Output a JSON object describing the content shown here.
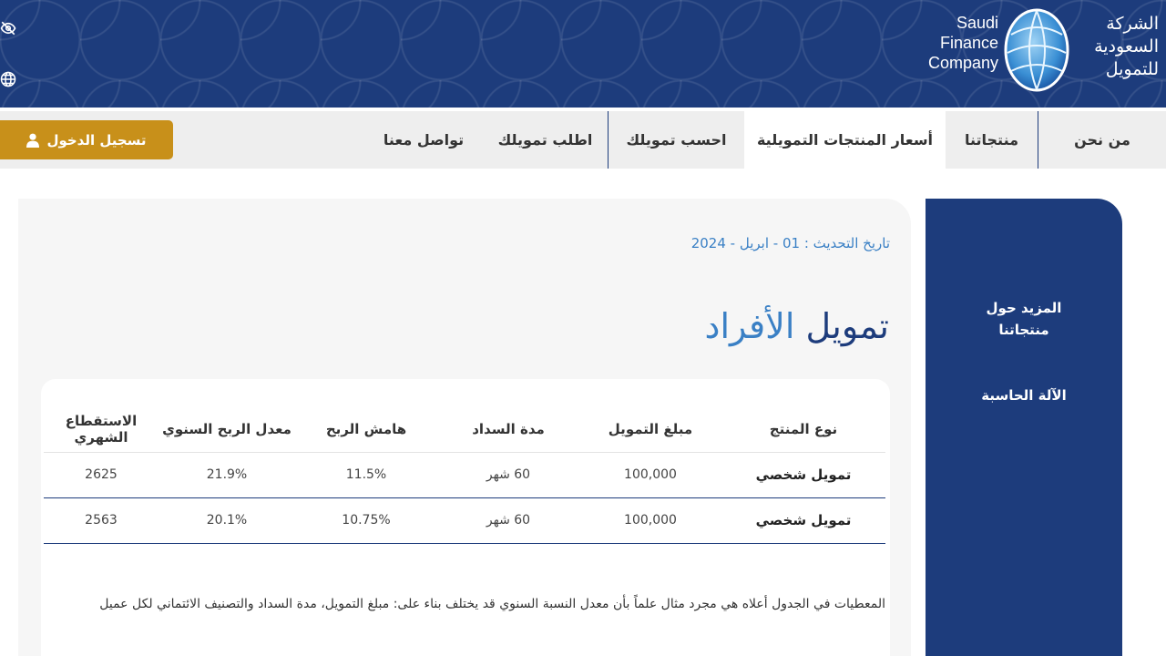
{
  "logo": {
    "en_lines": [
      "Saudi",
      "Finance",
      "Company"
    ],
    "ar_lines": [
      "الشركة",
      "السعودية",
      "للتمويل"
    ]
  },
  "nav": {
    "items": [
      "من نحن",
      "منتجاتنا",
      "أسعار المنتجات التمويلية",
      "احسب تمويلك",
      "اطلب تمويلك",
      "تواصل معنا"
    ],
    "active": "أسعار المنتجات التمويلية",
    "login_label": "تسجيل الدخول"
  },
  "sidebar": {
    "items": [
      "المزيد حول منتجاتنا",
      "الآلة الحاسبة"
    ]
  },
  "main": {
    "update_date": "تاريخ التحديث : 01 - ابريل - 2024",
    "title_part1": "تمويل",
    "title_part2": "الأفراد",
    "table": {
      "headers": [
        "نوع المنتج",
        "مبلغ التمويل",
        "مدة السداد",
        "هامش الربح",
        "معدل الربح السنوي",
        "الاستقطاع الشهري"
      ],
      "rows": [
        [
          "تمويل شخصي",
          "100,000",
          "60 شهر",
          "11.5%",
          "21.9%",
          "2625"
        ],
        [
          "تمويل شخصي",
          "100,000",
          "60 شهر",
          "10.75%",
          "20.1%",
          "2563"
        ]
      ]
    },
    "disclaimer": "المعطيات في الجدول أعلاه هي مجرد مثال علماً بأن معدل النسبة السنوي قد يختلف بناء على: مبلغ التمويل، مدة السداد والتصنيف الائتماني لكل عميل"
  },
  "colors": {
    "brand_navy": "#1d3c7c",
    "accent_blue": "#3a80c5",
    "login_gold": "#c8901a"
  },
  "icons": [
    "eye-slash-icon",
    "globe-icon",
    "user-icon",
    "logo-globe-icon"
  ]
}
